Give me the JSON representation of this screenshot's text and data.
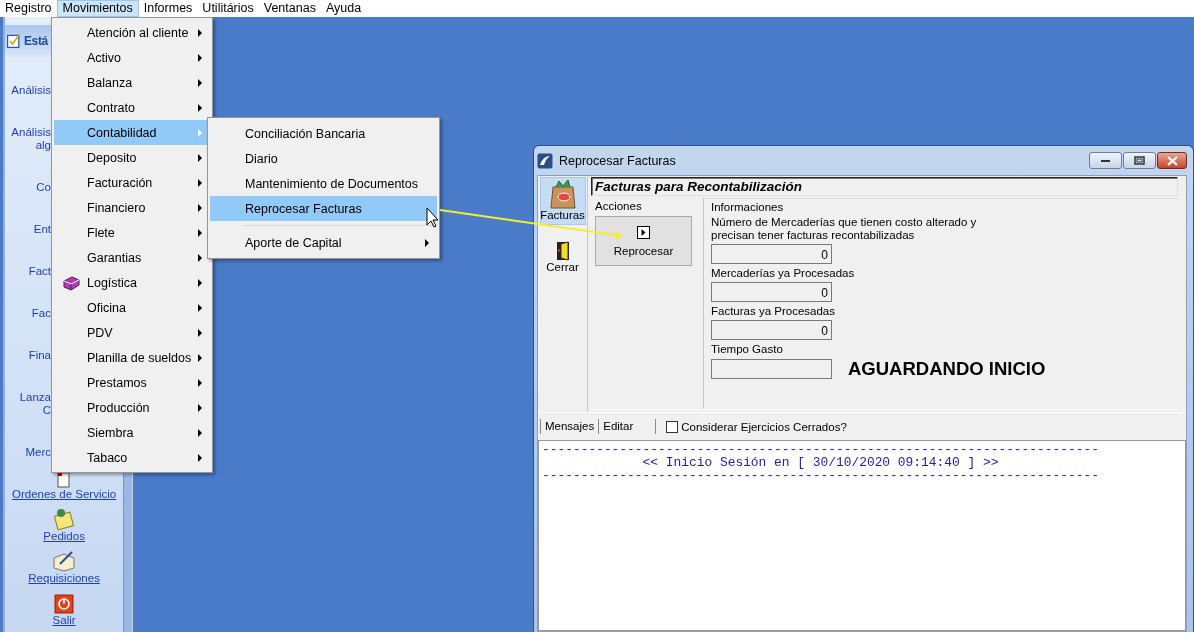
{
  "menubar": [
    {
      "label": "Registro",
      "selected": false
    },
    {
      "label": "Movimientos",
      "selected": true
    },
    {
      "label": "Informes",
      "selected": false
    },
    {
      "label": "Utilitários",
      "selected": false
    },
    {
      "label": "Ventanas",
      "selected": false
    },
    {
      "label": "Ayuda",
      "selected": false
    }
  ],
  "sidebar": {
    "title": "Está",
    "items": [
      {
        "lines": [
          "Análisis"
        ],
        "covered": true
      },
      {
        "lines": [
          "Análisis",
          "alg"
        ],
        "covered": true
      },
      {
        "lines": [
          "Co"
        ],
        "covered": true
      },
      {
        "lines": [
          "Ent"
        ],
        "covered": true
      },
      {
        "lines": [
          "Fact"
        ],
        "covered": true
      },
      {
        "lines": [
          "Fac"
        ],
        "covered": true
      },
      {
        "lines": [
          "Fina"
        ],
        "covered": true
      },
      {
        "lines": [
          "Lanza",
          "C"
        ],
        "covered": true
      },
      {
        "lines": [
          "Merc"
        ],
        "covered": true
      },
      {
        "lines": [
          "Ordenes de Servicio"
        ],
        "covered": false
      },
      {
        "lines": [
          "Pedidos"
        ],
        "covered": false
      },
      {
        "lines": [
          "Requisiciones"
        ],
        "covered": false
      },
      {
        "lines": [
          "Salir"
        ],
        "covered": false
      }
    ]
  },
  "menu": {
    "items": [
      {
        "label": "Atención al cliente",
        "selected": false,
        "has_icon": false
      },
      {
        "label": "Activo",
        "selected": false,
        "has_icon": false
      },
      {
        "label": "Balanza",
        "selected": false,
        "has_icon": false
      },
      {
        "label": "Contrato",
        "selected": false,
        "has_icon": false
      },
      {
        "label": "Contabilidad",
        "selected": true,
        "has_icon": false
      },
      {
        "label": "Deposito",
        "selected": false,
        "has_icon": false
      },
      {
        "label": "Facturación",
        "selected": false,
        "has_icon": false
      },
      {
        "label": "Financiero",
        "selected": false,
        "has_icon": false
      },
      {
        "label": "Flete",
        "selected": false,
        "has_icon": false
      },
      {
        "label": "Garantias",
        "selected": false,
        "has_icon": false
      },
      {
        "label": "Logística",
        "selected": false,
        "has_icon": true
      },
      {
        "label": "Oficina",
        "selected": false,
        "has_icon": false
      },
      {
        "label": "PDV",
        "selected": false,
        "has_icon": false
      },
      {
        "label": "Planilla de sueldos",
        "selected": false,
        "has_icon": false
      },
      {
        "label": "Prestamos",
        "selected": false,
        "has_icon": false
      },
      {
        "label": "Producción",
        "selected": false,
        "has_icon": false
      },
      {
        "label": "Siembra",
        "selected": false,
        "has_icon": false
      },
      {
        "label": "Tabaco",
        "selected": false,
        "has_icon": false
      }
    ]
  },
  "submenu": {
    "items": [
      {
        "kind": "item",
        "label": "Conciliación Bancaria",
        "selected": false,
        "submenu": false
      },
      {
        "kind": "item",
        "label": "Diario",
        "selected": false,
        "submenu": false
      },
      {
        "kind": "item",
        "label": "Mantenimiento de Documentos",
        "selected": false,
        "submenu": false
      },
      {
        "kind": "item",
        "label": "Reprocesar Facturas",
        "selected": true,
        "submenu": false
      },
      {
        "kind": "separator"
      },
      {
        "kind": "item",
        "label": "Aporte de Capital",
        "selected": false,
        "submenu": true
      }
    ]
  },
  "window": {
    "title": "Reprocesar Facturas",
    "toolbar": [
      {
        "kind": "bag",
        "label": "Facturas",
        "selected": true
      },
      {
        "kind": "door",
        "label": "Cerrar",
        "selected": false
      }
    ],
    "heading": "Facturas para Recontabilización",
    "actions": {
      "title": "Acciones",
      "button": "Reprocesar"
    },
    "info": {
      "title": "Informaciones",
      "fields": [
        {
          "label": "Número de Mercaderías que tienen costo alterado y precisan tener facturas recontabilizadas",
          "value": "0"
        },
        {
          "label": "Mercaderías ya Procesadas",
          "value": "0"
        },
        {
          "label": "Facturas ya Procesadas",
          "value": "0"
        },
        {
          "label": "Tiempo Gasto"
        }
      ],
      "status": "AGUARDANDO INICIO"
    },
    "tabs": [
      "Mensajes",
      "Editar"
    ],
    "checkbox": {
      "label": "Considerar Ejercicios Cerrados?",
      "checked": false
    },
    "log": [
      "------------------------------------------------------------------------",
      "<< Inicio Sesión en [ 30/10/2020 09:14:40 ] >>",
      "------------------------------------------------------------------------"
    ]
  }
}
